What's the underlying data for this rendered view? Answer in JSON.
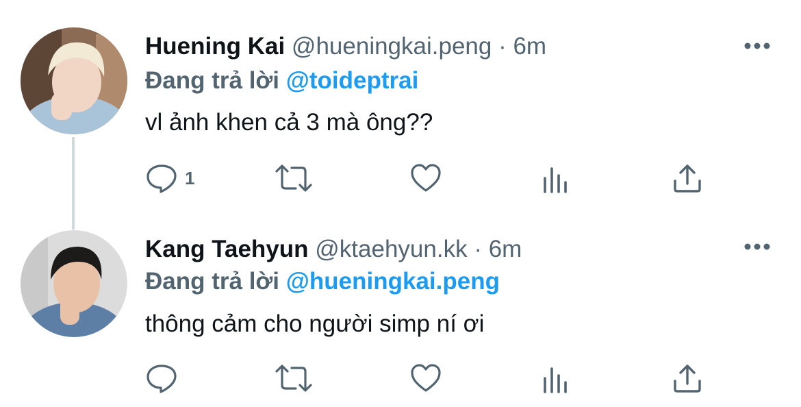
{
  "tweets": [
    {
      "name": "Huening Kai",
      "handle": "@hueningkai.peng",
      "time": "6m",
      "replying_prefix": "Đang trả lời",
      "replying_to": "@toideptrai",
      "text": "vl ảnh khen cả 3 mà ông??",
      "reply_count": "1",
      "avatar_icon": "avatar-photo-blond"
    },
    {
      "name": "Kang Taehyun",
      "handle": "@ktaehyun.kk",
      "time": "6m",
      "replying_prefix": "Đang trả lời",
      "replying_to": "@hueningkai.peng",
      "text": "thông cảm cho người simp ní ơi",
      "reply_count": "",
      "avatar_icon": "avatar-photo-dark-hair"
    }
  ],
  "separator": " · ",
  "icons": [
    "reply-icon",
    "retweet-icon",
    "like-icon",
    "views-icon",
    "share-icon",
    "more-icon"
  ],
  "colors": {
    "text": "#0f1419",
    "secondary": "#536471",
    "accent": "#1d9bf0",
    "thread_line": "#cfd9de"
  }
}
